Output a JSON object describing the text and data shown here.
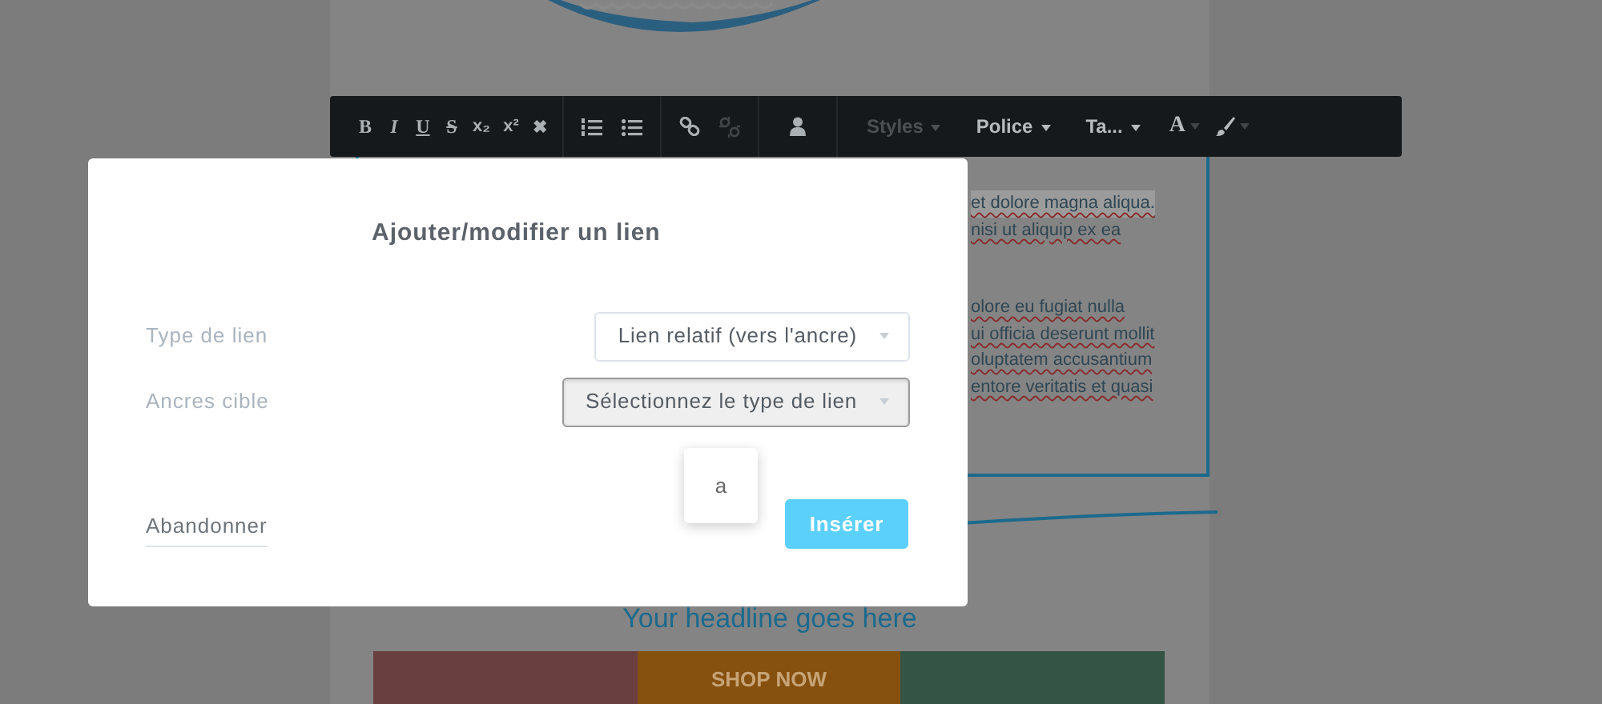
{
  "toolbar": {
    "format_buttons": [
      "B",
      "I",
      "U",
      "S",
      "x₂",
      "x²",
      "✖"
    ],
    "icon_buttons": [
      {
        "disabled": false
      },
      {
        "disabled": false
      },
      {
        "disabled": false
      },
      {
        "disabled": true
      },
      {
        "disabled": false
      }
    ],
    "dropdowns": [
      {
        "label": "Styles",
        "disabled": true
      },
      {
        "label": "Police",
        "disabled": false
      },
      {
        "label": "Ta...",
        "disabled": false
      }
    ],
    "color_button": "A"
  },
  "editor": {
    "paragraphs": [
      [
        {
          "text": "et dolore magna aliqua.",
          "highlighted": true
        },
        {
          "text": "nisi ut aliquip ex ea",
          "highlighted": false
        }
      ],
      [
        {
          "text": "olore eu fugiat nulla",
          "highlighted": false
        },
        {
          "text": "ui officia deserunt mollit",
          "highlighted": false
        },
        {
          "text": "oluptatem accusantium",
          "highlighted": false
        },
        {
          "text": "entore veritatis et quasi",
          "highlighted": false
        }
      ]
    ],
    "headline": "Your headline goes here",
    "tiles": [
      {
        "color": "#6a3f3f"
      },
      {
        "color": "#86500f",
        "label": "SHOP NOW"
      },
      {
        "color": "#345446"
      }
    ]
  },
  "dialog": {
    "title": "Ajouter/modifier un lien",
    "fields": [
      {
        "label": "Type de lien",
        "value": "Lien relatif (vers l'ancre)",
        "focused": false
      },
      {
        "label": "Ancres cible",
        "value": "Sélectionnez le type de lien",
        "focused": true
      }
    ],
    "dropdown_options": [
      {
        "label": "a"
      }
    ],
    "cancel": "Abandonner",
    "submit": "Insérer"
  }
}
